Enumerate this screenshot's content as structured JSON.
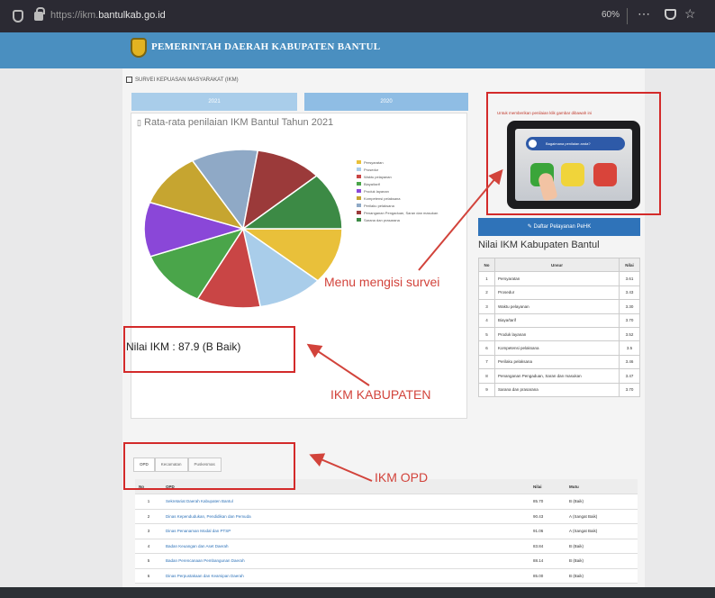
{
  "browser": {
    "url_prefix": "https://ikm.",
    "url_domain": "bantulkab.go.id",
    "zoom": "60%",
    "menu_icon": "⋯",
    "pocket_icon": "pocket-icon",
    "star_icon": "☆"
  },
  "header": {
    "title": "PEMERINTAH DAERAH KABUPATEN BANTUL"
  },
  "breadcrumb": "SURVEI KEPUASAN MASYARAKAT (IKM)",
  "tabs": [
    "2021",
    "2020"
  ],
  "chart_panel": {
    "title": "Rata-rata penilaian IKM Bantul Tahun 2021"
  },
  "chart_data": {
    "type": "pie",
    "title": "Rata-rata penilaian IKM Bantul Tahun 2021",
    "categories": [
      "Persyaratan",
      "Prosedur",
      "Waktu pelayanan",
      "Biaya/tarif",
      "Produk layanan",
      "Kompetensi pelaksana",
      "Perilaku pelaksana",
      "Penanganan Pengaduan, Saran dan masukan",
      "Sarana dan prasarana"
    ],
    "values": [
      3.61,
      3.43,
      3.3,
      3.7,
      3.52,
      3.5,
      3.46,
      3.47,
      3.7
    ],
    "colors": [
      "#e9c03a",
      "#a9cdea",
      "#c94545",
      "#4aa54a",
      "#8a47d8",
      "#c6a530",
      "#8fa9c6",
      "#9b3a3a",
      "#3c8a45"
    ],
    "legend": "right"
  },
  "nilai_ikm": "Nilai IKM : 87.9 (B Baik)",
  "annotations": {
    "survey": "Menu mengisi survei",
    "kabupaten": "IKM KABUPATEN",
    "opd": "IKM OPD"
  },
  "promo": {
    "caption": "Untuk memberikan penilaian klik gambar dibawah ini",
    "screen_text": "Bagaimana penilaian anda?"
  },
  "survey_button": "Daftar Pelayanan PeHK",
  "side_table": {
    "title": "Nilai IKM Kabupaten Bantul",
    "headers": [
      "No",
      "Unsur",
      "Nilai"
    ],
    "rows": [
      [
        "1",
        "Persyaratan",
        "3.61"
      ],
      [
        "2",
        "Prosedur",
        "3.43"
      ],
      [
        "3",
        "Waktu pelayanan",
        "3.30"
      ],
      [
        "4",
        "Biaya/tarif",
        "3.70"
      ],
      [
        "5",
        "Produk layanan",
        "3.52"
      ],
      [
        "6",
        "Kompetensi pelaksana",
        "3.5"
      ],
      [
        "7",
        "Perilaku pelaksana",
        "3.46"
      ],
      [
        "8",
        "Penanganan Pengaduan, Saran dan masukan",
        "3.47"
      ],
      [
        "9",
        "Sarana dan prasarana",
        "3.70"
      ]
    ]
  },
  "opd_tabs": [
    "OPD",
    "Kecamatan",
    "Puskesmas"
  ],
  "opd_table": {
    "headers": [
      "No",
      "OPD",
      "Nilai",
      "Mutu"
    ],
    "rows": [
      [
        "1",
        "Sekretariat Daerah Kabupaten Bantul",
        "85.70",
        "B (Baik)"
      ],
      [
        "2",
        "Dinas Kependudukan, Pendidikan dan Pemuda",
        "90.43",
        "A (Sangat Baik)"
      ],
      [
        "3",
        "Dinas Penanaman Modal dan PTSP",
        "91.06",
        "A (Sangat Baik)"
      ],
      [
        "4",
        "Badan Keuangan dan Aset Daerah",
        "83.84",
        "B (Baik)"
      ],
      [
        "5",
        "Badan Perencanaan Pembangunan Daerah",
        "88.14",
        "B (Baik)"
      ],
      [
        "6",
        "Dinas Perpustakaan dan Kearsipan Daerah",
        "85.00",
        "B (Baik)"
      ]
    ]
  }
}
